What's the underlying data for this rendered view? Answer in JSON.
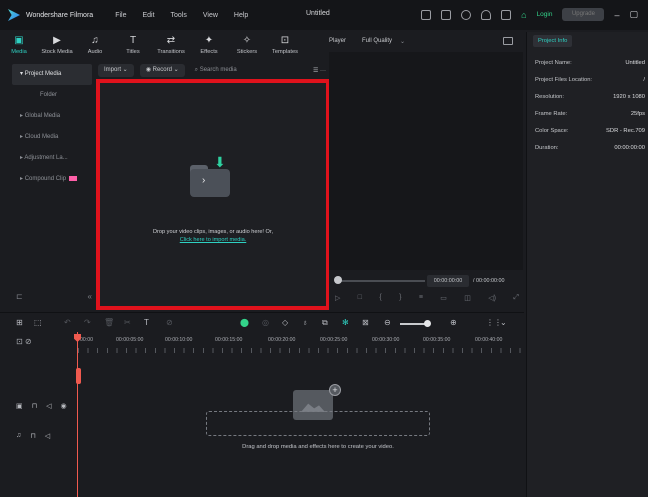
{
  "titlebar": {
    "app_name": "Wondershare Filmora",
    "menu": [
      "File",
      "Edit",
      "Tools",
      "View",
      "Help"
    ],
    "project_title": "Untitled",
    "login": "Login",
    "upgrade": "Upgrade",
    "window_buttons": [
      "–",
      "▢"
    ]
  },
  "toolbar": {
    "tabs": [
      {
        "label": "Media",
        "icon": "media-icon"
      },
      {
        "label": "Stock Media",
        "icon": "stock-media-icon"
      },
      {
        "label": "Audio",
        "icon": "audio-icon"
      },
      {
        "label": "Titles",
        "icon": "titles-icon"
      },
      {
        "label": "Transitions",
        "icon": "transitions-icon"
      },
      {
        "label": "Effects",
        "icon": "effects-icon"
      },
      {
        "label": "Stickers",
        "icon": "stickers-icon"
      },
      {
        "label": "Templates",
        "icon": "templates-icon"
      }
    ],
    "active_tab": "Media"
  },
  "sidebar": {
    "items": [
      {
        "label": "Project Media",
        "prefix": "▾"
      },
      {
        "label": "Folder",
        "prefix": ""
      },
      {
        "label": "Global Media",
        "prefix": "▸"
      },
      {
        "label": "Cloud Media",
        "prefix": "▸"
      },
      {
        "label": "Adjustment La...",
        "prefix": "▸"
      },
      {
        "label": "Compound Clip",
        "prefix": "▸"
      }
    ]
  },
  "media_bar": {
    "import": "Import",
    "record": "Record",
    "search_placeholder": "Search media"
  },
  "drop_panel": {
    "text": "Drop your video clips, images, or audio here! Or,",
    "link": "Click here to import media."
  },
  "player": {
    "label": "Player",
    "quality": "Full Quality",
    "current_time": "00:00:00:00",
    "total_time": "/ 00:00:00:00"
  },
  "properties": {
    "tab": "Project Info",
    "rows": [
      {
        "key": "Project Name:",
        "value": "Untitled"
      },
      {
        "key": "Project Files Location:",
        "value": "/"
      },
      {
        "key": "Resolution:",
        "value": "1920 x 1080"
      },
      {
        "key": "Frame Rate:",
        "value": "25fps"
      },
      {
        "key": "Color Space:",
        "value": "SDR - Rec.709"
      },
      {
        "key": "Duration:",
        "value": "00:00:00:00"
      }
    ]
  },
  "timeline": {
    "ruler": [
      "00:00",
      "00:00:05:00",
      "00:00:10:00",
      "00:00:15:00",
      "00:00:20:00",
      "00:00:25:00",
      "00:00:30:00",
      "00:00:35:00",
      "00:00:40:00"
    ],
    "hint": "Drag and drop media and effects here to create your video."
  },
  "colors": {
    "accent": "#2ed1c2",
    "highlight_box": "#e0121c",
    "playhead": "#f05a4f",
    "login_green": "#33d38a"
  }
}
